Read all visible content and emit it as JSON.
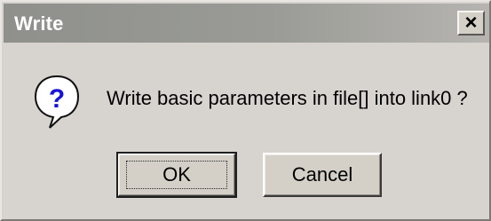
{
  "window": {
    "title": "Write"
  },
  "titlebar": {
    "close_glyph": "×"
  },
  "dialog": {
    "icon": "question-icon",
    "message": "Write basic parameters in file[] into link0 ?"
  },
  "buttons": {
    "ok_label": "OK",
    "cancel_label": "Cancel"
  },
  "colors": {
    "titlebar": "#9a9b96",
    "dialog_bg": "#d7d3cf",
    "icon_blue": "#1714d8"
  }
}
